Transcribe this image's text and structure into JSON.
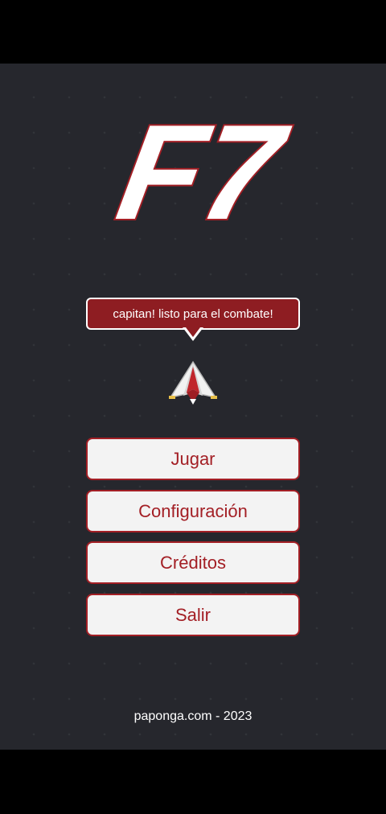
{
  "logo": {
    "text": "F7"
  },
  "speech_bubble": {
    "text": "capitan! listo para el combate!"
  },
  "menu": {
    "play_label": "Jugar",
    "settings_label": "Configuración",
    "credits_label": "Créditos",
    "exit_label": "Salir"
  },
  "footer": {
    "text": "paponga.com - 2023"
  },
  "icons": {
    "ship": "spaceship-icon"
  },
  "colors": {
    "background": "#26272d",
    "accent_red": "#a31f25",
    "bubble_red": "#8e1d22",
    "button_bg": "#f3f3f3"
  }
}
